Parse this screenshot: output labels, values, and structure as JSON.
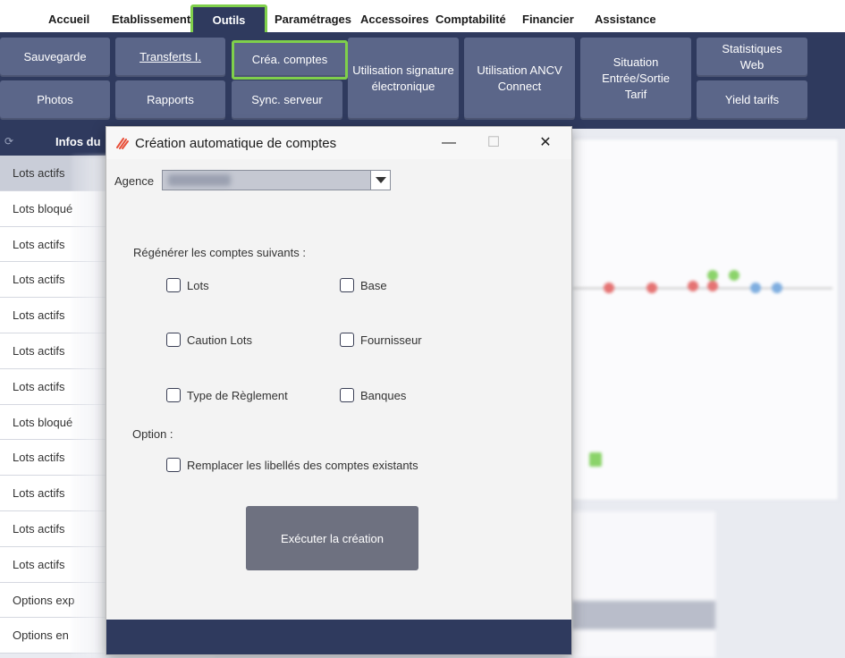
{
  "menu": {
    "items": [
      "Accueil",
      "Etablissement",
      "Outils",
      "Paramétrages",
      "Accessoires",
      "Comptabilité",
      "Financier",
      "Assistance"
    ],
    "active": "Outils"
  },
  "toolbar": {
    "sauvegarde": "Sauvegarde",
    "transferts": "Transferts I.",
    "crea_comptes": "Créa. comptes",
    "signature": "Utilisation signature électronique",
    "ancv": "Utilisation ANCV Connect",
    "situation": "Situation Entrée/Sortie Tarif",
    "statistiques": "Statistiques Web",
    "photos": "Photos",
    "rapports": "Rapports",
    "sync": "Sync. serveur",
    "yield": "Yield tarifs"
  },
  "left_panel": {
    "header": "Infos du",
    "rows": [
      "Lots actifs",
      "Lots bloqué",
      "Lots actifs",
      "Lots actifs",
      "Lots actifs",
      "Lots actifs",
      "Lots actifs",
      "Lots bloqué",
      "Lots actifs",
      "Lots actifs",
      "Lots actifs",
      "Lots actifs",
      "Options exp",
      "Options en"
    ]
  },
  "dialog": {
    "title": "Création automatique de comptes",
    "agence_label": "Agence",
    "regenerate_label": "Régénérer les comptes suivants :",
    "checkboxes": {
      "lots": "Lots",
      "base": "Base",
      "caution_lots": "Caution Lots",
      "fournisseur": "Fournisseur",
      "type_reglement": "Type de Règlement",
      "banques": "Banques"
    },
    "option_label": "Option :",
    "replace_label": "Remplacer les libellés des comptes existants",
    "execute": "Exécuter la création",
    "minimize_icon": "minimize-icon",
    "maximize_icon": "maximize-icon",
    "close_icon": "close-icon"
  },
  "colors": {
    "navy": "#2f3a5e",
    "button": "#5b6689",
    "highlight": "#7fd04b",
    "execute_button": "#6e7180"
  }
}
